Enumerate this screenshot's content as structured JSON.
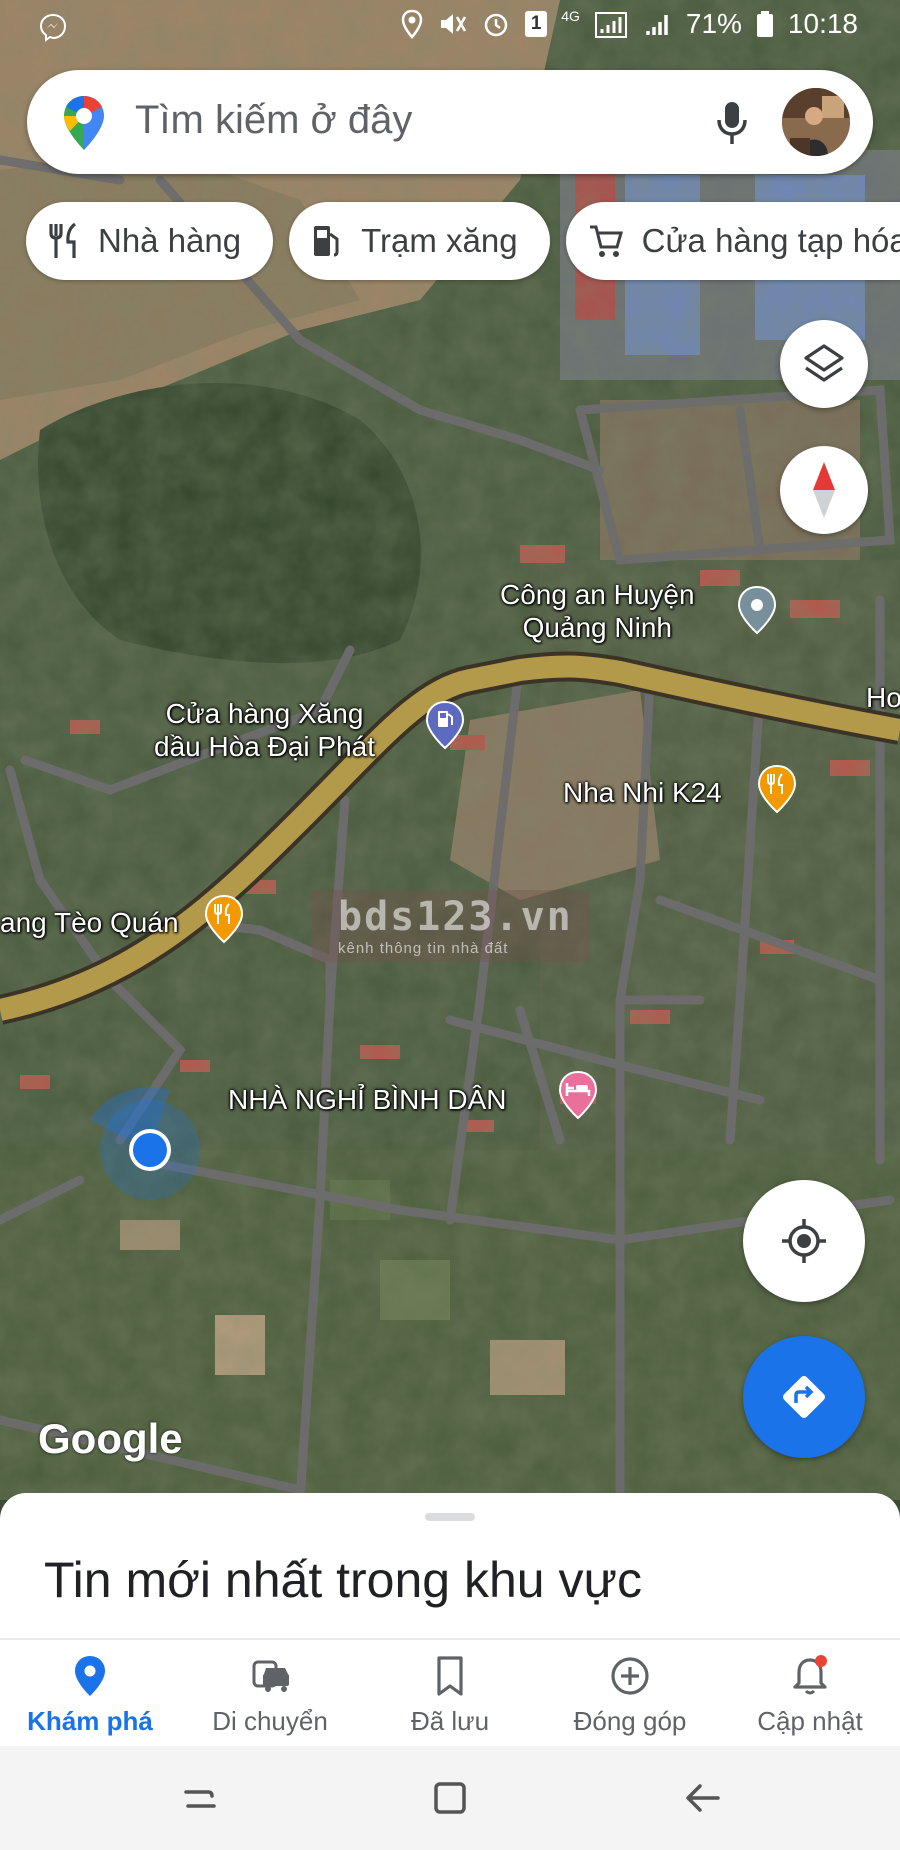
{
  "status_bar": {
    "battery": "71%",
    "time": "10:18",
    "network": "4G",
    "notification_count": "1"
  },
  "search": {
    "placeholder": "Tìm kiếm ở đây"
  },
  "chips": [
    {
      "label": "Nhà hàng",
      "icon": "fork-knife-icon"
    },
    {
      "label": "Trạm xăng",
      "icon": "gas-pump-icon"
    },
    {
      "label": "Cửa hàng tạp hóa",
      "icon": "shopping-cart-icon"
    }
  ],
  "map": {
    "places": {
      "police": "Công an Huyện\nQuảng Ninh",
      "gas_station": "Cửa hàng Xăng\ndầu Hòa Đại Phát",
      "restaurant_k24": "Nha Nhi K24",
      "teo_quan": "ang Tèo Quán",
      "guesthouse": "NHÀ NGHỈ BÌNH DÂN",
      "edge_label": "Ho"
    },
    "watermark": {
      "main": "bds123.vn",
      "sub": "kênh thông tin nhà đất"
    },
    "attribution": "Google",
    "colors": {
      "restaurant_pin": "#f29900",
      "gas_pin": "#5c6bc0",
      "hotel_pin": "#e8709a",
      "police_pin": "#78909c",
      "my_location": "#1a73e8",
      "main_road": "#b39a4a"
    }
  },
  "bottom_sheet": {
    "title": "Tin mới nhất trong khu vực"
  },
  "bottom_nav": [
    {
      "label": "Khám phá",
      "icon": "explore-pin-icon",
      "active": true
    },
    {
      "label": "Di chuyển",
      "icon": "commute-icon",
      "active": false
    },
    {
      "label": "Đã lưu",
      "icon": "bookmark-icon",
      "active": false
    },
    {
      "label": "Đóng góp",
      "icon": "add-circle-icon",
      "active": false
    },
    {
      "label": "Cập nhật",
      "icon": "bell-icon",
      "active": false
    }
  ]
}
